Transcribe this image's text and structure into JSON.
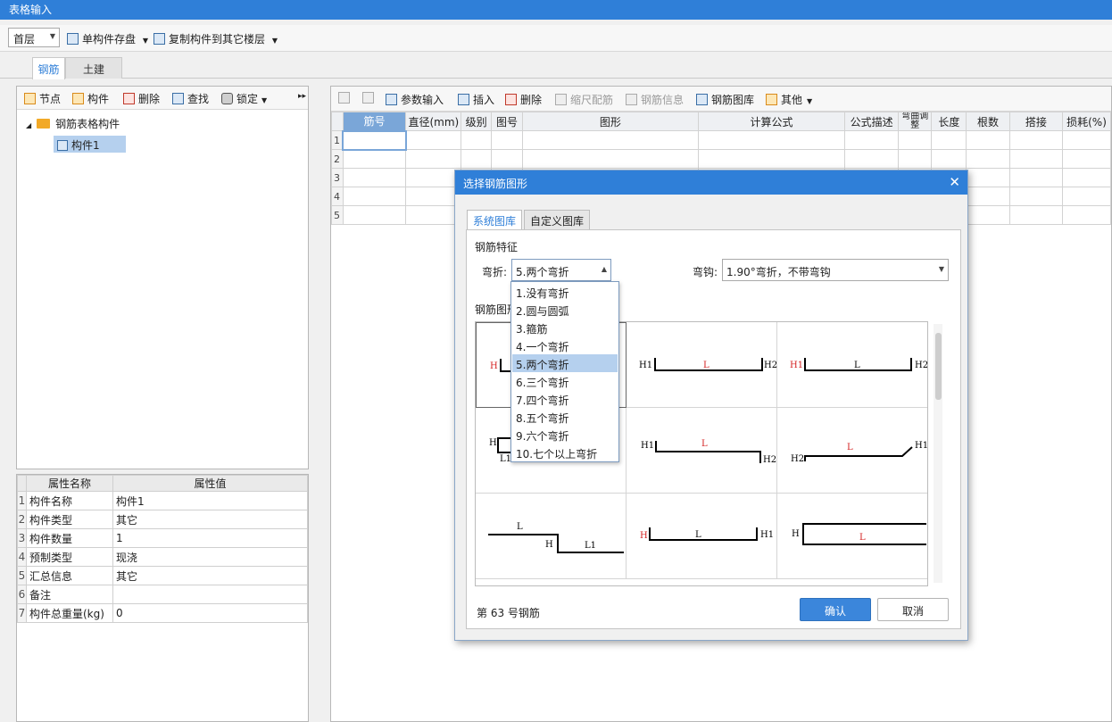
{
  "window": {
    "title": "表格输入"
  },
  "toolbar": {
    "floor": "首层",
    "save_component": "单构件存盘",
    "copy_to_floor": "复制构件到其它楼层"
  },
  "main_tabs": [
    {
      "label": "钢筋"
    },
    {
      "label": "土建"
    }
  ],
  "left_toolbar": {
    "node": "节点",
    "component": "构件",
    "delete": "删除",
    "find": "查找",
    "lock": "锁定"
  },
  "tree": {
    "root": "钢筋表格构件",
    "child": "构件1"
  },
  "props": {
    "header": [
      "属性名称",
      "属性值"
    ],
    "rows": [
      {
        "num": "1",
        "name": "构件名称",
        "value": "构件1"
      },
      {
        "num": "2",
        "name": "构件类型",
        "value": "其它"
      },
      {
        "num": "3",
        "name": "构件数量",
        "value": "1"
      },
      {
        "num": "4",
        "name": "预制类型",
        "value": "现浇"
      },
      {
        "num": "5",
        "name": "汇总信息",
        "value": "其它"
      },
      {
        "num": "6",
        "name": "备注",
        "value": ""
      },
      {
        "num": "7",
        "name": "构件总重量(kg)",
        "value": "0"
      }
    ]
  },
  "right_toolbar": {
    "param_input": "参数输入",
    "insert": "插入",
    "delete": "删除",
    "scale_rebar": "缩尺配筋",
    "rebar_info": "钢筋信息",
    "rebar_lib": "钢筋图库",
    "other": "其他"
  },
  "grid": {
    "columns": [
      "筋号",
      "直径(mm)",
      "级别",
      "图号",
      "图形",
      "计算公式",
      "公式描述",
      "弯曲调整",
      "长度",
      "根数",
      "搭接",
      "损耗(%)"
    ],
    "rows": [
      "1",
      "2",
      "3",
      "4",
      "5"
    ]
  },
  "dialog": {
    "title": "选择钢筋图形",
    "tabs": [
      "系统图库",
      "自定义图库"
    ],
    "feature_label": "钢筋特征",
    "bend_label": "弯折:",
    "bend_value": "5.两个弯折",
    "hook_label": "弯钩:",
    "hook_value": "1.90°弯折，不带弯钩",
    "shapes_label": "钢筋图形",
    "status": "第 63 号钢筋",
    "ok": "确认",
    "cancel": "取消",
    "bend_options": [
      "1.没有弯折",
      "2.圆与圆弧",
      "3.箍筋",
      "4.一个弯折",
      "5.两个弯折",
      "6.三个弯折",
      "7.四个弯折",
      "8.五个弯折",
      "9.六个弯折",
      "10.七个以上弯折"
    ]
  },
  "shape_labels": {
    "h": "H",
    "h1": "H1",
    "h2": "H2",
    "l": "L",
    "l1": "L1"
  },
  "colors": {
    "accent": "#2f7fd8",
    "selected": "#b5d0ee",
    "label_red": "#d42020"
  }
}
